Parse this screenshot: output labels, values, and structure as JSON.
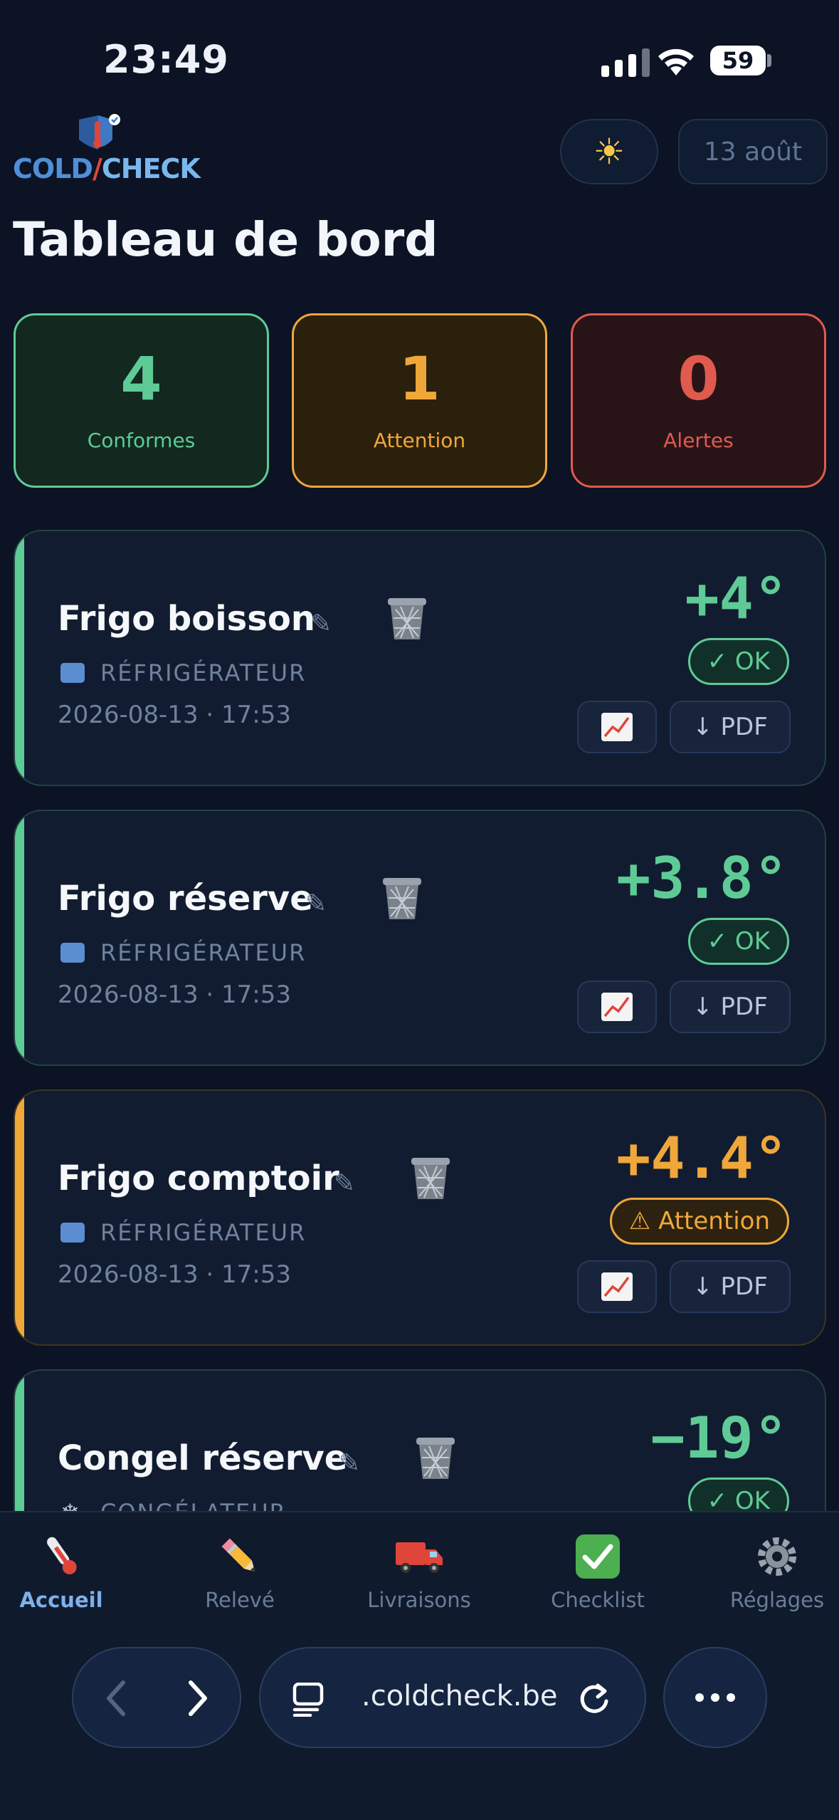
{
  "status_bar": {
    "time": "23:49",
    "battery": "59"
  },
  "header": {
    "logo": {
      "part1": "COLD",
      "slash": "/",
      "part2": "CHECK"
    },
    "theme_icon": "sun-icon",
    "date": "13 août",
    "title": "Tableau de bord"
  },
  "stats": [
    {
      "value": "4",
      "label": "Conformes",
      "color": "#5ecb96"
    },
    {
      "value": "1",
      "label": "Attention",
      "color": "#f0a73a"
    },
    {
      "value": "0",
      "label": "Alertes",
      "color": "#e05a4e"
    }
  ],
  "cards": [
    {
      "name": "Frigo boisson",
      "type": "RÉFRIGÉRATEUR",
      "datetime": "2026-08-13 · 17:53",
      "temp": "+4°",
      "status": "✓ OK",
      "pdf_label": "↓ PDF",
      "accent": "#5ecb96"
    },
    {
      "name": "Frigo réserve",
      "type": "RÉFRIGÉRATEUR",
      "datetime": "2026-08-13 · 17:53",
      "temp": "+3.8°",
      "status": "✓ OK",
      "pdf_label": "↓ PDF",
      "accent": "#5ecb96"
    },
    {
      "name": "Frigo comptoir",
      "type": "RÉFRIGÉRATEUR",
      "datetime": "2026-08-13 · 17:53",
      "temp": "+4.4°",
      "status": "⚠ Attention",
      "pdf_label": "↓ PDF",
      "accent": "#f0a73a"
    },
    {
      "name": "Congel réserve",
      "type": "CONGÉLATEUR",
      "temp": "−19°",
      "status": "✓ OK",
      "accent": "#5ecb96"
    }
  ],
  "nav": [
    {
      "label": "Accueil",
      "icon": "thermometer-icon",
      "active": true
    },
    {
      "label": "Relevé",
      "icon": "pencil-icon"
    },
    {
      "label": "Livraisons",
      "icon": "truck-icon"
    },
    {
      "label": "Checklist",
      "icon": "check-box-icon"
    },
    {
      "label": "Réglages",
      "icon": "gear-icon"
    }
  ],
  "browser": {
    "url": ".coldcheck.be"
  }
}
